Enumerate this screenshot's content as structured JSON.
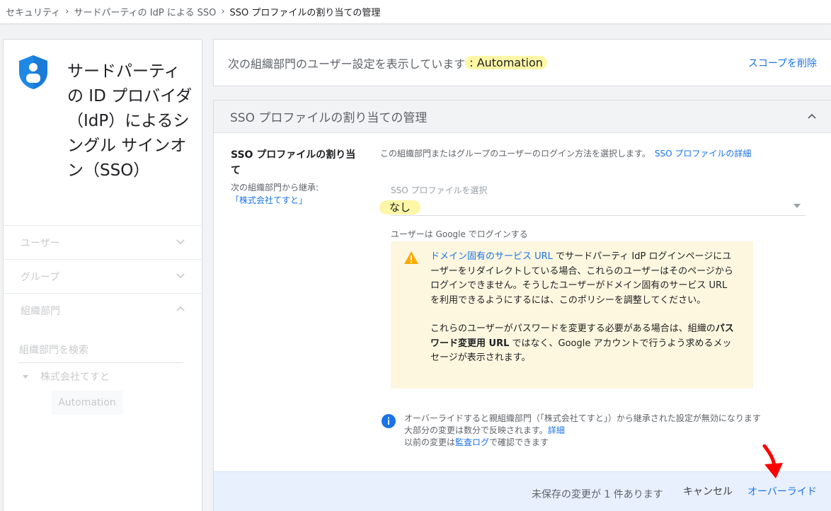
{
  "breadcrumb": {
    "items": [
      "セキュリティ",
      "サードパーティの IdP による SSO",
      "SSO プロファイルの割り当ての管理"
    ]
  },
  "sidebar": {
    "app_title": "サードパーティの ID プロバイダ（IdP）によるシングル サインオン（SSO）",
    "nav": [
      {
        "label": "ユーザー",
        "expanded": false
      },
      {
        "label": "グループ",
        "expanded": false
      },
      {
        "label": "組織部門",
        "expanded": true
      }
    ],
    "search_placeholder": "組織部門を検索",
    "tree_root": "株式会社てすと",
    "tree_child": "Automation"
  },
  "scope": {
    "label": "次の組織部門のユーザー設定を表示しています",
    "colon": ":",
    "org": "Automation",
    "remove": "スコープを削除"
  },
  "card": {
    "header": "SSO プロファイルの割り当ての管理",
    "setting_title": "SSO プロファイルの割り当て",
    "inherit_label": "次の組織部門から継承:",
    "inherit_ou": "「株式会社てすと」",
    "description": "この組織部門またはグループのユーザーのログイン方法を選択します。",
    "description_link": "SSO プロファイルの詳細",
    "select_label": "SSO プロファイルを選択",
    "select_value": "なし",
    "login_label": "ユーザーは Google でログインする",
    "warning": {
      "link": "ドメイン固有のサービス URL",
      "text1": " でサードパーティ IdP ログインページにユーザーをリダイレクトしている場合、これらのユーザーはそのページからログインできません。そうしたユーザーがドメイン固有のサービス URL を利用できるようにするには、このポリシーを調整してください。",
      "text2_a": "これらのユーザーがパスワードを変更する必要がある場合は、組織の",
      "text2_bold": "パスワード変更用 URL",
      "text2_b": " ではなく、Google アカウントで行うよう求めるメッセージが表示されます。"
    },
    "info": {
      "line1": "オーバーライドすると親組織部門（「株式会社てすと」）から継承された設定が無効になります",
      "line2": "大部分の変更は数分で反映されます。",
      "line2_link": "詳細",
      "line3_a": "以前の変更は",
      "line3_link": "監査ログ",
      "line3_b": "で確認できます"
    }
  },
  "footer": {
    "unsaved": "未保存の変更が 1 件あります",
    "cancel": "キャンセル",
    "override": "オーバーライド"
  },
  "colors": {
    "accent": "#1a73e8",
    "highlight": "#fdf6a6",
    "warning_bg": "#fef7e0",
    "footer_bg": "#e8f0fe",
    "annotation_arrow": "#ff0000"
  }
}
